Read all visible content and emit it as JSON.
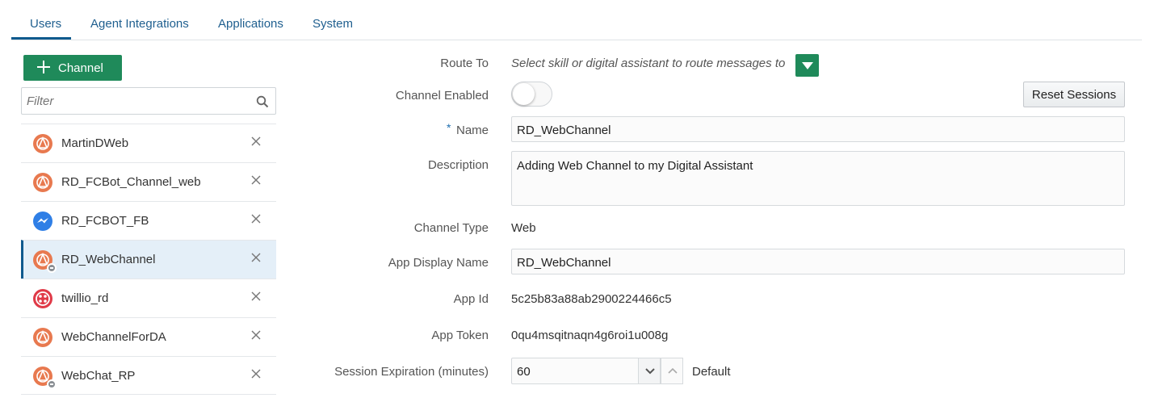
{
  "tabs": [
    {
      "label": "Users"
    },
    {
      "label": "Agent Integrations"
    },
    {
      "label": "Applications"
    },
    {
      "label": "System"
    }
  ],
  "sidebar": {
    "add_button_label": "Channel",
    "filter_placeholder": "Filter",
    "items": [
      {
        "name": "MartinDWeb",
        "icon": "web-channel-icon",
        "selected": false
      },
      {
        "name": "RD_FCBot_Channel_web",
        "icon": "web-channel-icon",
        "selected": false
      },
      {
        "name": "RD_FCBOT_FB",
        "icon": "facebook-messenger-icon",
        "selected": false
      },
      {
        "name": "RD_WebChannel",
        "icon": "web-channel-icon",
        "selected": true
      },
      {
        "name": "twillio_rd",
        "icon": "twilio-icon",
        "selected": false
      },
      {
        "name": "WebChannelForDA",
        "icon": "web-channel-icon",
        "selected": false
      },
      {
        "name": "WebChat_RP",
        "icon": "web-channel-icon",
        "selected": false
      }
    ]
  },
  "form": {
    "route_to_label": "Route To",
    "route_to_placeholder": "Select skill or digital assistant to route messages to",
    "channel_enabled_label": "Channel Enabled",
    "reset_sessions_label": "Reset Sessions",
    "name_required_marker": "*",
    "name_label": "Name",
    "name_value": "RD_WebChannel",
    "description_label": "Description",
    "description_value": "Adding Web Channel to my Digital Assistant",
    "channel_type_label": "Channel Type",
    "channel_type_value": "Web",
    "app_display_name_label": "App Display Name",
    "app_display_name_value": "RD_WebChannel",
    "app_id_label": "App Id",
    "app_id_value": "5c25b83a88ab2900224466c5",
    "app_token_label": "App Token",
    "app_token_value": "0qu4msqitnaqn4g6roi1u008g",
    "session_expiration_label": "Session Expiration (minutes)",
    "session_expiration_value": "60",
    "session_default_label": "Default"
  },
  "colors": {
    "accent_green": "#1f8a5a",
    "tab_blue": "#0f5a8e",
    "selected_bg": "#e4eff8"
  }
}
